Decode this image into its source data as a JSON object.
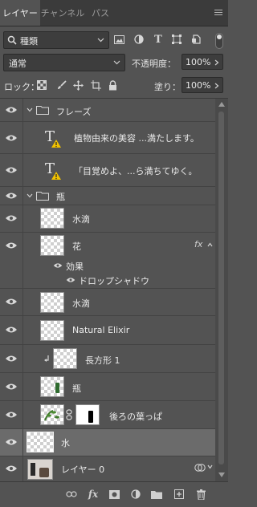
{
  "tabs": [
    {
      "label": "レイヤー",
      "active": true
    },
    {
      "label": "チャンネル",
      "active": false
    },
    {
      "label": "パス",
      "active": false
    }
  ],
  "filter": {
    "kind_label": "種類",
    "icons": [
      "pixel-filter-icon",
      "adjustment-filter-icon",
      "type-filter-icon",
      "shape-filter-icon",
      "smart-object-filter-icon"
    ]
  },
  "blend": {
    "mode": "通常",
    "opacity_label": "不透明度：",
    "opacity_value": "100%"
  },
  "lock": {
    "label": "ロック：",
    "fill_label": "塗り：",
    "fill_value": "100%"
  },
  "layers": [
    {
      "name": "フレーズ",
      "kind": "group"
    },
    {
      "name": "植物由来の美容 ...満たします。",
      "kind": "text"
    },
    {
      "name": "「目覚めよ、...ら満ちてゆく。",
      "kind": "text"
    },
    {
      "name": "瓶",
      "kind": "group"
    },
    {
      "name": "水滴",
      "kind": "pixel"
    },
    {
      "name": "花",
      "kind": "pixel",
      "fx": "fx"
    },
    {
      "name": "効果",
      "kind": "effects-header"
    },
    {
      "name": "ドロップシャドウ",
      "kind": "effect"
    },
    {
      "name": "水滴",
      "kind": "pixel"
    },
    {
      "name": "Natural Elixir",
      "kind": "pixel"
    },
    {
      "name": "長方形 1",
      "kind": "pixel"
    },
    {
      "name": "瓶",
      "kind": "pixel"
    },
    {
      "name": "後ろの葉っぱ",
      "kind": "masked"
    },
    {
      "name": "水",
      "kind": "pixel",
      "selected": true
    },
    {
      "name": "レイヤー 0",
      "kind": "photo"
    }
  ],
  "colors": {
    "panel": "#535353",
    "tabbar": "#3b3b3b",
    "selected": "#6b6b6b",
    "warning": "#f2c200"
  }
}
